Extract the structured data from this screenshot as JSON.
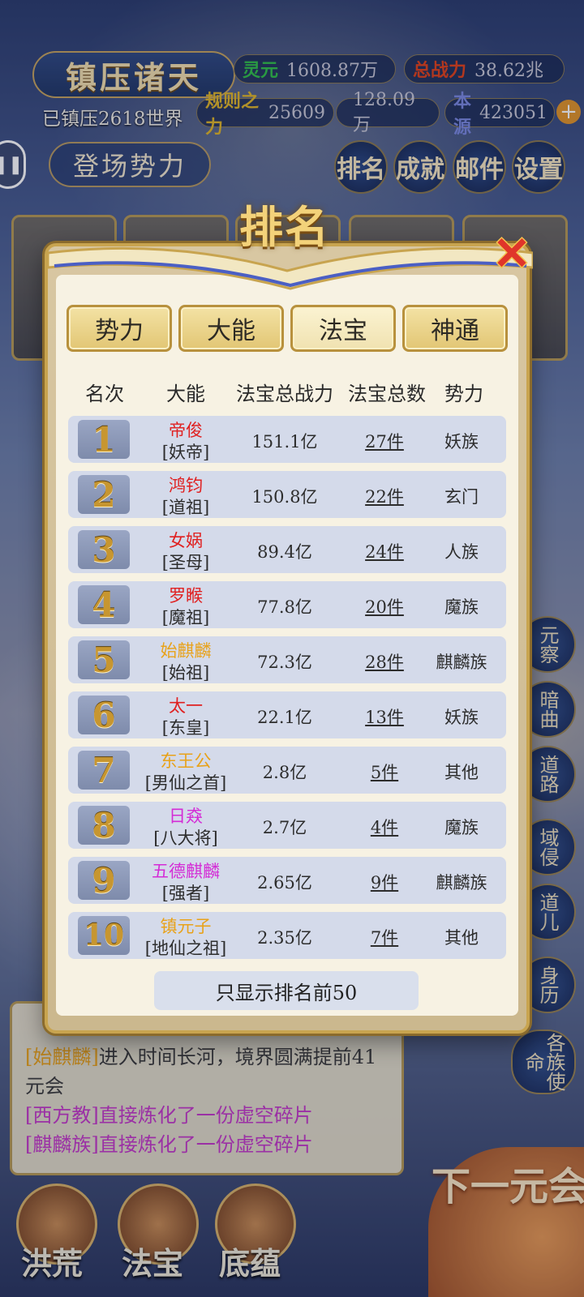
{
  "header": {
    "title": "镇压诸天",
    "world_text": "已镇压2618世界",
    "stats": [
      {
        "key": "灵元",
        "value": "1608.87万",
        "color": "#33c24a"
      },
      {
        "key": "总战力",
        "value": "38.62兆",
        "color": "#e2431c"
      },
      {
        "key": "规则之力",
        "value": "25609",
        "color": "#e0b62a"
      },
      {
        "key": "",
        "value": "128.09万",
        "color": "#d96ad6"
      },
      {
        "key": "本源",
        "value": "423051",
        "color": "#7b89e0"
      }
    ],
    "enter_label": "登场势力",
    "top_icons": [
      "排名",
      "成就",
      "邮件",
      "设置"
    ]
  },
  "modal": {
    "title": "排名",
    "tabs": [
      "势力",
      "大能",
      "法宝",
      "神通"
    ],
    "active_tab": "法宝",
    "columns": [
      "名次",
      "大能",
      "法宝总战力",
      "法宝总数",
      "势力"
    ],
    "rows": [
      {
        "rank": "1",
        "name": "帝俊",
        "title": "[妖帝]",
        "power": "151.1亿",
        "count": "27件",
        "faction": "妖族",
        "name_color": "#e02020"
      },
      {
        "rank": "2",
        "name": "鸿钧",
        "title": "[道祖]",
        "power": "150.8亿",
        "count": "22件",
        "faction": "玄门",
        "name_color": "#e02020"
      },
      {
        "rank": "3",
        "name": "女娲",
        "title": "[圣母]",
        "power": "89.4亿",
        "count": "24件",
        "faction": "人族",
        "name_color": "#e02020"
      },
      {
        "rank": "4",
        "name": "罗睺",
        "title": "[魔祖]",
        "power": "77.8亿",
        "count": "20件",
        "faction": "魔族",
        "name_color": "#e02020"
      },
      {
        "rank": "5",
        "name": "始麒麟",
        "title": "[始祖]",
        "power": "72.3亿",
        "count": "28件",
        "faction": "麒麟族",
        "name_color": "#e8a21a"
      },
      {
        "rank": "6",
        "name": "太一",
        "title": "[东皇]",
        "power": "22.1亿",
        "count": "13件",
        "faction": "妖族",
        "name_color": "#e02020"
      },
      {
        "rank": "7",
        "name": "东王公",
        "title": "[男仙之首]",
        "power": "2.8亿",
        "count": "5件",
        "faction": "其他",
        "name_color": "#e8a21a"
      },
      {
        "rank": "8",
        "name": "日猋",
        "title": "[八大将]",
        "power": "2.7亿",
        "count": "4件",
        "faction": "魔族",
        "name_color": "#d42cd6"
      },
      {
        "rank": "9",
        "name": "五德麒麟",
        "title": "[强者]",
        "power": "2.65亿",
        "count": "9件",
        "faction": "麒麟族",
        "name_color": "#d42cd6"
      },
      {
        "rank": "10",
        "name": "镇元子",
        "title": "[地仙之祖]",
        "power": "2.35亿",
        "count": "7件",
        "faction": "其他",
        "name_color": "#e8a21a"
      }
    ],
    "notice": "只显示排名前50"
  },
  "chat": {
    "lines": [
      {
        "who": "[始麒麟]",
        "text": "进入时间长河，境界圆满提前41元会",
        "color": "#e8a21a"
      },
      {
        "who": "[西方教]",
        "text": "直接炼化了一份虚空碎片",
        "color": "#c43ac8"
      },
      {
        "who": "[麒麟族]",
        "text": "直接炼化了一份虚空碎片",
        "color": "#c43ac8"
      }
    ]
  },
  "side_buttons": [
    "元察",
    "暗曲",
    "道路",
    "域侵",
    "道儿",
    "身历",
    "各族使命"
  ],
  "bottom_nav": [
    "洪荒",
    "法宝",
    "底蕴"
  ],
  "next_era": "下一元会"
}
